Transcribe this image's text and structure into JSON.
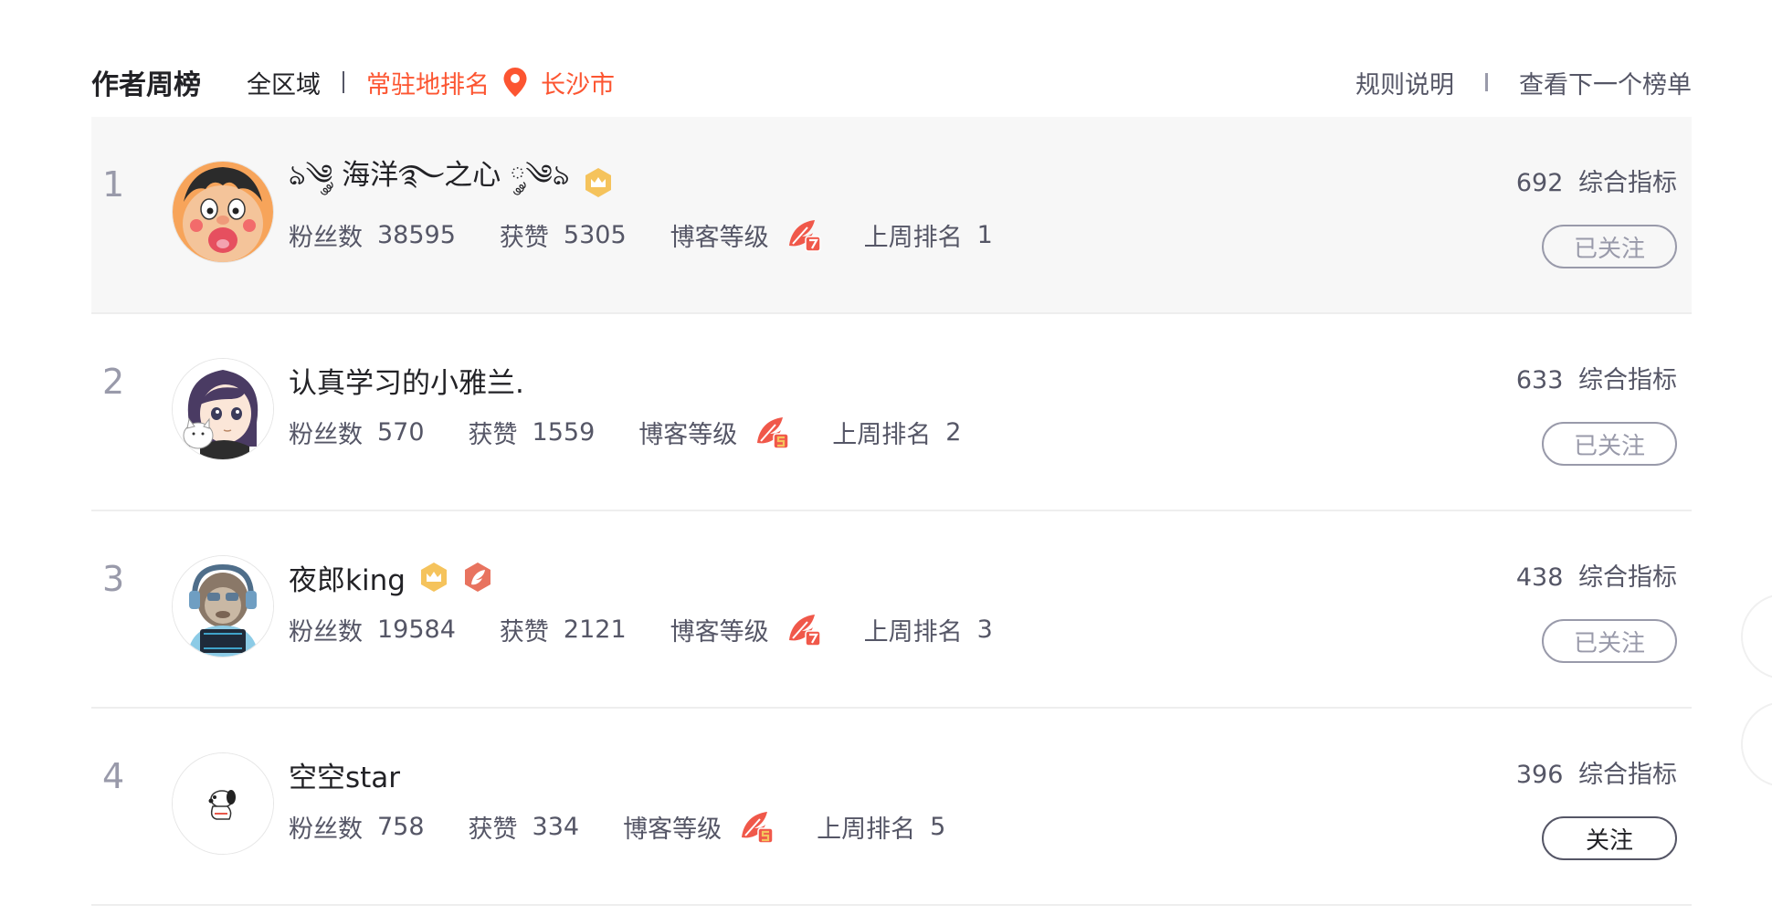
{
  "header": {
    "title": "作者周榜",
    "tab_all": "全区域",
    "tab_resident": "常驻地排名",
    "city": "长沙市",
    "rules_link": "规则说明",
    "next_board_link": "查看下一个榜单"
  },
  "colors": {
    "accent": "#fc5531",
    "text_primary": "#222226",
    "text_secondary": "#555666",
    "text_muted": "#999aaa"
  },
  "labels": {
    "fans": "粉丝数",
    "likes": "获赞",
    "blog_level": "博客等级",
    "last_week_rank": "上周排名",
    "score_suffix": "综合指标"
  },
  "rows": [
    {
      "rank": "1",
      "name": "ঌ༄༘ 海洋࿐之心 ༘༄ঌ",
      "fans": "38595",
      "likes": "5305",
      "last_week_rank": "1",
      "score": "692",
      "follow_label": "已关注",
      "followed": true,
      "avatar_icon": "cartoon-boy-avatar",
      "badges": [
        "crown-badge"
      ],
      "level_icon": "blog-level-7-icon"
    },
    {
      "rank": "2",
      "name": "认真学习的小雅兰.",
      "fans": "570",
      "likes": "1559",
      "last_week_rank": "2",
      "score": "633",
      "follow_label": "已关注",
      "followed": true,
      "avatar_icon": "anime-girl-cat-avatar",
      "badges": [],
      "level_icon": "blog-level-5-icon"
    },
    {
      "rank": "3",
      "name": "夜郎king",
      "fans": "19584",
      "likes": "2121",
      "last_week_rank": "3",
      "score": "438",
      "follow_label": "已关注",
      "followed": true,
      "avatar_icon": "monkey-headphones-avatar",
      "badges": [
        "crown-badge",
        "feather-badge"
      ],
      "level_icon": "blog-level-7-icon"
    },
    {
      "rank": "4",
      "name": "空空star",
      "fans": "758",
      "likes": "334",
      "last_week_rank": "5",
      "score": "396",
      "follow_label": "关注",
      "followed": false,
      "avatar_icon": "snoopy-avatar",
      "badges": [],
      "level_icon": "blog-level-5-icon"
    }
  ]
}
